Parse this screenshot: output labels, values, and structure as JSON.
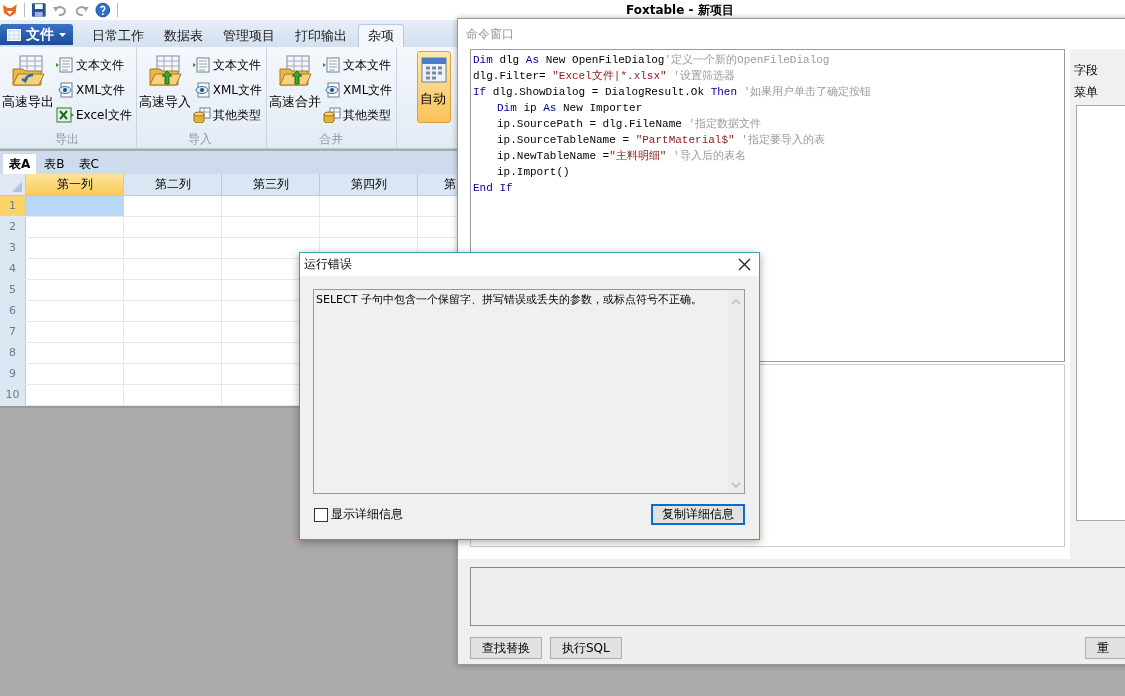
{
  "window": {
    "title": "Foxtable - 新项目"
  },
  "ribbon": {
    "file_menu": "文件",
    "tabs": [
      {
        "label": "日常工作",
        "selected": false
      },
      {
        "label": "数据表",
        "selected": false
      },
      {
        "label": "管理项目",
        "selected": false
      },
      {
        "label": "打印输出",
        "selected": false
      },
      {
        "label": "杂项",
        "selected": true
      }
    ],
    "groups": [
      {
        "title": "导出",
        "large": {
          "label": "高速导出",
          "kind": "export"
        },
        "items": [
          {
            "label": "文本文件",
            "kind": "text"
          },
          {
            "label": "XML文件",
            "kind": "xml"
          },
          {
            "label": "Excel文件",
            "kind": "excel"
          }
        ]
      },
      {
        "title": "导入",
        "large": {
          "label": "高速导入",
          "kind": "import"
        },
        "items": [
          {
            "label": "文本文件",
            "kind": "text"
          },
          {
            "label": "XML文件",
            "kind": "xml"
          },
          {
            "label": "其他类型",
            "kind": "other"
          }
        ]
      },
      {
        "title": "合并",
        "large": {
          "label": "高速合并",
          "kind": "import"
        },
        "items": [
          {
            "label": "文本文件",
            "kind": "text"
          },
          {
            "label": "XML文件",
            "kind": "xml"
          },
          {
            "label": "其他类型",
            "kind": "other"
          }
        ]
      }
    ],
    "partial_button": "自动"
  },
  "sheet_tabs": [
    {
      "label": "表A",
      "selected": true
    },
    {
      "label": "表B",
      "selected": false
    },
    {
      "label": "表C",
      "selected": false
    }
  ],
  "grid": {
    "columns": [
      {
        "label": "第一列",
        "selected": true
      },
      {
        "label": "第二列",
        "selected": false
      },
      {
        "label": "第三列",
        "selected": false
      },
      {
        "label": "第四列",
        "selected": false
      },
      {
        "label": "第",
        "selected": false
      }
    ],
    "rows": [
      {
        "label": "1",
        "selected": true
      },
      {
        "label": "2",
        "selected": false
      },
      {
        "label": "3",
        "selected": false
      },
      {
        "label": "4",
        "selected": false
      },
      {
        "label": "5",
        "selected": false
      },
      {
        "label": "6",
        "selected": false
      },
      {
        "label": "7",
        "selected": false
      },
      {
        "label": "8",
        "selected": false
      },
      {
        "label": "9",
        "selected": false
      },
      {
        "label": "10",
        "selected": false
      }
    ]
  },
  "command_window": {
    "title": "命令窗口",
    "code": [
      {
        "tokens": [
          {
            "kind": "keyword",
            "text": "Dim"
          },
          {
            "kind": "plain",
            "text": " dlg "
          },
          {
            "kind": "keyword",
            "text": "As"
          },
          {
            "kind": "plain",
            "text": " New OpenFileDialog"
          },
          {
            "kind": "comment",
            "text": "'定义一个新的OpenFileDialog"
          }
        ]
      },
      {
        "tokens": [
          {
            "kind": "plain",
            "text": "dlg.Filter= "
          },
          {
            "kind": "string",
            "text": "\"Excel文件|*.xlsx\""
          },
          {
            "kind": "comment",
            "text": " '设置筛选器"
          }
        ]
      },
      {
        "tokens": [
          {
            "kind": "keyword",
            "text": "If"
          },
          {
            "kind": "plain",
            "text": " dlg.ShowDialog = DialogResult.Ok "
          },
          {
            "kind": "keyword",
            "text": "Then"
          },
          {
            "kind": "comment",
            "text": " '如果用户单击了确定按钮"
          }
        ],
        "children": [
          {
            "tokens": [
              {
                "kind": "keyword",
                "text": "Dim"
              },
              {
                "kind": "plain",
                "text": " ip "
              },
              {
                "kind": "keyword",
                "text": "As"
              },
              {
                "kind": "plain",
                "text": " New Importer"
              }
            ]
          },
          {
            "tokens": [
              {
                "kind": "plain",
                "text": "ip.SourcePath = dlg.FileName "
              },
              {
                "kind": "comment",
                "text": "'指定数据文件"
              }
            ]
          },
          {
            "tokens": [
              {
                "kind": "plain",
                "text": "ip.SourceTableName = "
              },
              {
                "kind": "string",
                "text": "\"PartMaterial$\""
              },
              {
                "kind": "comment",
                "text": " '指定要导入的表"
              }
            ]
          },
          {
            "tokens": [
              {
                "kind": "plain",
                "text": "ip.NewTableName ="
              },
              {
                "kind": "string",
                "text": "\"主料明细\""
              },
              {
                "kind": "comment",
                "text": " '导入后的表名"
              }
            ]
          },
          {
            "tokens": [
              {
                "kind": "plain",
                "text": "ip.Import()"
              }
            ]
          }
        ]
      },
      {
        "tokens": [
          {
            "kind": "keyword",
            "text": "End If"
          }
        ]
      }
    ],
    "side_tabs": [
      "字段",
      "菜单"
    ],
    "buttons": [
      "查找替换",
      "执行SQL"
    ],
    "right_button": "重"
  },
  "error_dialog": {
    "title": "运行错误",
    "message": "SELECT 子句中包含一个保留字、拼写错误或丢失的参数，或标点符号不正确。",
    "show_details": {
      "label": "显示详细信息",
      "checked": false
    },
    "button": "复制详细信息"
  }
}
